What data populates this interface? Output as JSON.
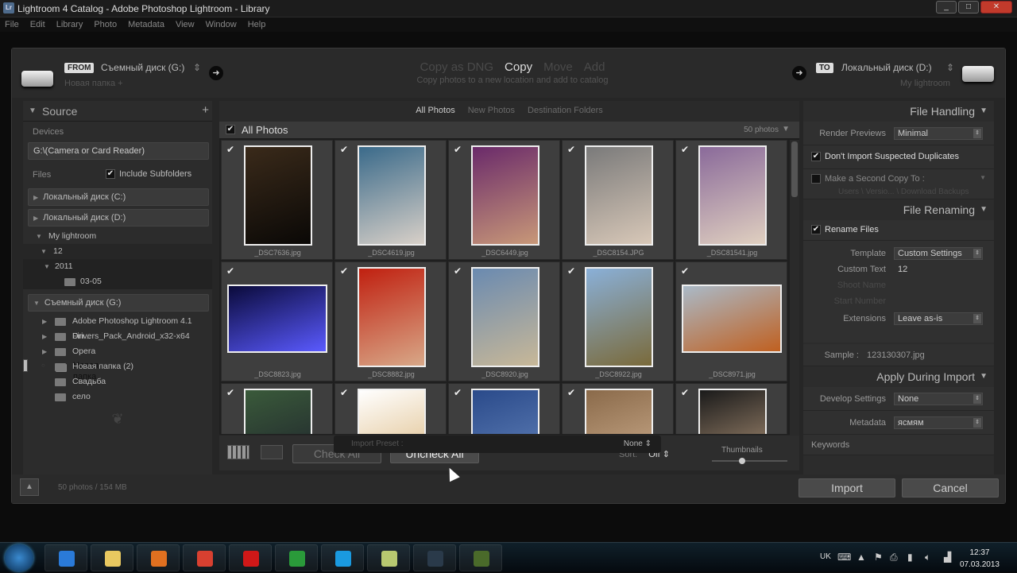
{
  "window": {
    "app_icon": "Lr",
    "title": "Lightroom 4 Catalog - Adobe Photoshop Lightroom - Library",
    "min": "_",
    "max": "□",
    "close": "✕"
  },
  "menu": [
    "File",
    "Edit",
    "Library",
    "Photo",
    "Metadata",
    "View",
    "Window",
    "Help"
  ],
  "top": {
    "from_badge": "FROM",
    "from_drive": "Съемный диск (G:)",
    "from_sub": "Новая папка +",
    "to_badge": "TO",
    "to_drive": "Локальный диск (D:)",
    "to_sub": "My lightroom",
    "modes": [
      "Copy as DNG",
      "Copy",
      "Move",
      "Add"
    ],
    "mode_sub": "Copy photos to a new location and add to catalog"
  },
  "source": {
    "title": "Source",
    "plus": "+",
    "devices_label": "Devices",
    "device": "G:\\(Camera or Card Reader)",
    "files_label": "Files",
    "include_subfolders": "Include Subfolders",
    "disk_c": "Локальный диск (C:)",
    "disk_d": "Локальный диск (D:)",
    "tree": [
      {
        "name": "My lightroom",
        "indent": 0
      },
      {
        "name": "12",
        "indent": 1
      },
      {
        "name": "2011",
        "indent": 1
      },
      {
        "name": "03-05",
        "indent": 2
      }
    ],
    "disk_g": "Съемный диск (G:)",
    "folders": [
      "Adobe Photoshop Lightroom 4.1 Fin...",
      "Drivers_Pack_Android_x32-x64",
      "Opera",
      "Новая папка",
      "Новая папка (2)",
      "Свадьба",
      "село"
    ]
  },
  "center": {
    "tabs": [
      "All Photos",
      "New Photos",
      "Destination Folders"
    ],
    "all_photos": "All Photos",
    "count": "50 photos",
    "photos": [
      {
        "file": "_DSC7636.jpg",
        "orient": "p",
        "c1": "#3a2a1a",
        "c2": "#0a0806"
      },
      {
        "file": "_DSC4619.jpg",
        "orient": "p",
        "c1": "#3a6a8a",
        "c2": "#d8d0c8"
      },
      {
        "file": "_DSC6449.jpg",
        "orient": "p",
        "c1": "#6a2a6a",
        "c2": "#c89878"
      },
      {
        "file": "_DSC8154.JPG",
        "orient": "p",
        "c1": "#7a7a7a",
        "c2": "#d8c8b8"
      },
      {
        "file": "_DSC81541.jpg",
        "orient": "p",
        "c1": "#8a6a9a",
        "c2": "#e0d0c0"
      },
      {
        "file": "_DSC8823.jpg",
        "orient": "l",
        "c1": "#0a0a3a",
        "c2": "#5a5aff"
      },
      {
        "file": "_DSC8882.jpg",
        "orient": "p",
        "c1": "#c02010",
        "c2": "#d8a888"
      },
      {
        "file": "_DSC8920.jpg",
        "orient": "p",
        "c1": "#6a8ab0",
        "c2": "#c8b898"
      },
      {
        "file": "_DSC8922.jpg",
        "orient": "p",
        "c1": "#8ab0d8",
        "c2": "#7a6a3a"
      },
      {
        "file": "_DSC8971.jpg",
        "orient": "l",
        "c1": "#aabac8",
        "c2": "#c06020"
      },
      {
        "file": "",
        "orient": "p",
        "c1": "#3a5a3a",
        "c2": "#1a1a2a"
      },
      {
        "file": "",
        "orient": "p",
        "c1": "#ffffff",
        "c2": "#d8b070"
      },
      {
        "file": "",
        "orient": "p",
        "c1": "#2a4a8a",
        "c2": "#6a8ac0"
      },
      {
        "file": "",
        "orient": "p",
        "c1": "#8a6a4a",
        "c2": "#d8b898"
      },
      {
        "file": "",
        "orient": "p",
        "c1": "#1a1a1a",
        "c2": "#c8a888"
      }
    ],
    "check_all": "Check All",
    "uncheck_all": "Uncheck All",
    "sort_label": "Sort:",
    "sort_value": "Off ⇕",
    "thumbnails": "Thumbnails",
    "thumb_size": 0.4
  },
  "right": {
    "file_handling": "File Handling",
    "render_label": "Render Previews",
    "render_value": "Minimal",
    "dont_import": "Don't Import Suspected Duplicates",
    "second_copy": "Make a Second Copy To :",
    "second_copy_path": "Users \\ Versio... \\ Download Backups",
    "file_renaming": "File Renaming",
    "rename_files": "Rename Files",
    "template_label": "Template",
    "template_value": "Custom Settings",
    "custom_text_label": "Custom Text",
    "custom_text_value": "12",
    "shoot_name": "Shoot Name",
    "start_number": "Start Number",
    "extensions_label": "Extensions",
    "extensions_value": "Leave as-is",
    "sample_label": "Sample :",
    "sample_value": "123130307.jpg",
    "apply_during": "Apply During Import",
    "develop_label": "Develop Settings",
    "develop_value": "None",
    "metadata_label": "Metadata",
    "metadata_value": "ясмям",
    "keywords_label": "Keywords"
  },
  "bottom": {
    "summary": "50 photos / 154 MB",
    "import_preset": "Import Preset :",
    "preset_value": "None ⇕",
    "import": "Import",
    "cancel": "Cancel"
  },
  "taskbar": {
    "lang": "UK",
    "time": "12:37",
    "date": "07.03.2013",
    "apps": [
      {
        "name": "ie-icon",
        "color": "#2a7ad8"
      },
      {
        "name": "explorer-icon",
        "color": "#e8c860"
      },
      {
        "name": "media-player-icon",
        "color": "#e07020"
      },
      {
        "name": "chrome-icon",
        "color": "#d84030"
      },
      {
        "name": "opera-icon",
        "color": "#d01818"
      },
      {
        "name": "utorrent-icon",
        "color": "#2a9a3a"
      },
      {
        "name": "skype-icon",
        "color": "#1a9ae0"
      },
      {
        "name": "notes-icon",
        "color": "#b8c870"
      },
      {
        "name": "lightroom-icon",
        "color": "#2a3a4a"
      },
      {
        "name": "camtasia-icon",
        "color": "#4a6a2a"
      }
    ]
  }
}
